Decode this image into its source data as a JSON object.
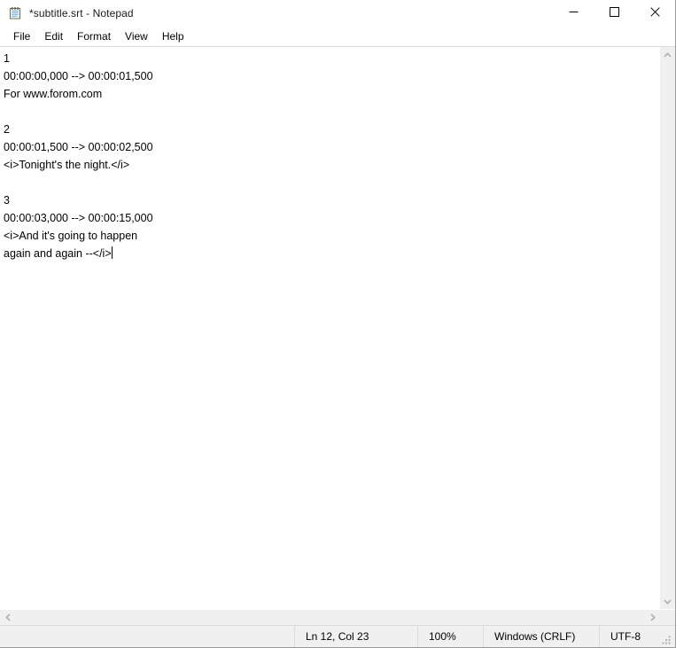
{
  "window": {
    "title": "*subtitle.srt - Notepad",
    "app_icon": "notepad-icon"
  },
  "caption": {
    "minimize": "—",
    "maximize": "☐",
    "close": "✕",
    "minimize_name": "minimize-button",
    "maximize_name": "maximize-button",
    "close_name": "close-button"
  },
  "menu": {
    "items": [
      {
        "label": "File"
      },
      {
        "label": "Edit"
      },
      {
        "label": "Format"
      },
      {
        "label": "View"
      },
      {
        "label": "Help"
      }
    ]
  },
  "editor": {
    "lines": [
      "1",
      "00:00:00,000 --> 00:00:01,500",
      "For www.forom.com",
      "",
      "2",
      "00:00:01,500 --> 00:00:02,500",
      "<i>Tonight's the night.</i>",
      "",
      "3",
      "00:00:03,000 --> 00:00:15,000",
      "<i>And it's going to happen",
      "again and again --</i>"
    ],
    "caret_line_index": 11
  },
  "scrollbars": {
    "vertical": {
      "up_arrow": "▴",
      "down_arrow": "▾"
    },
    "horizontal": {
      "left_arrow": "◂",
      "right_arrow": "▸"
    }
  },
  "statusbar": {
    "position": "Ln 12, Col 23",
    "zoom": "100%",
    "line_ending": "Windows (CRLF)",
    "encoding": "UTF-8"
  },
  "colors": {
    "window_bg": "#ffffff",
    "chrome_bg": "#f0f0f0",
    "text": "#000000",
    "border": "#dcdcdc",
    "close_hover": "#e81123"
  }
}
